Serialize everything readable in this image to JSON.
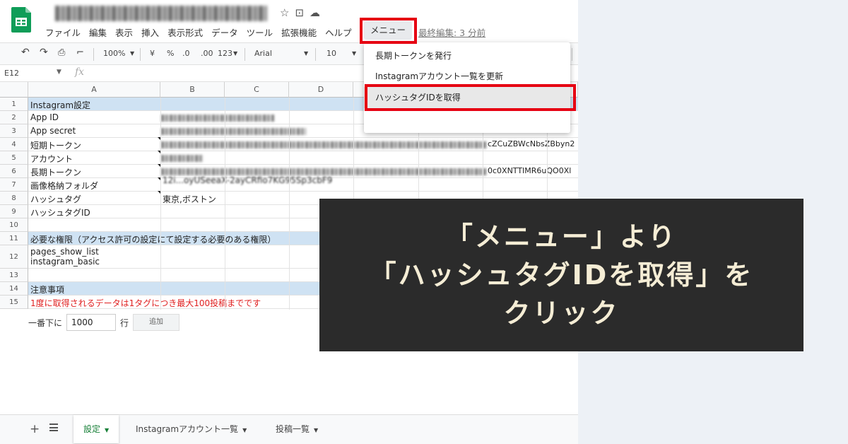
{
  "app": {
    "doc_title": "",
    "menus": [
      "ファイル",
      "編集",
      "表示",
      "挿入",
      "表示形式",
      "データ",
      "ツール",
      "拡張機能",
      "ヘルプ"
    ],
    "active_menu": "メニュー",
    "last_edit": "最終編集: 3 分前"
  },
  "toolbar": {
    "zoom": "100%",
    "currency": "¥",
    "percent": "%",
    "decimal_less": ".0",
    "decimal_more": ".00",
    "number_format": "123",
    "font": "Arial",
    "font_size": "10"
  },
  "formula_bar": {
    "name_box": "E12",
    "fx": "fx"
  },
  "columns": [
    "A",
    "B",
    "C",
    "D"
  ],
  "rows": [
    {
      "num": "1",
      "a": "Instagram設定",
      "b": ""
    },
    {
      "num": "2",
      "a": "App ID",
      "b": ""
    },
    {
      "num": "3",
      "a": "App secret",
      "b": ""
    },
    {
      "num": "4",
      "a": "短期トークン",
      "b": ""
    },
    {
      "num": "5",
      "a": "アカウント",
      "b": ""
    },
    {
      "num": "6",
      "a": "長期トークン",
      "b": ""
    },
    {
      "num": "7",
      "a": "画像格納フォルダ",
      "b": "12i...oyUSeeaX-2ayCRfio7KG95Sp3cbF9"
    },
    {
      "num": "8",
      "a": "ハッシュタグ",
      "b": "東京,ボストン"
    },
    {
      "num": "9",
      "a": "ハッシュタグID",
      "b": ""
    },
    {
      "num": "10",
      "a": "",
      "b": ""
    },
    {
      "num": "11",
      "a": "必要な権限（アクセス許可の設定にて設定する必要のある権限）",
      "b": ""
    },
    {
      "num": "12",
      "a": "pages_show_list",
      "a2": "instagram_basic",
      "b": ""
    },
    {
      "num": "13",
      "a": "",
      "b": ""
    },
    {
      "num": "14",
      "a": "注意事項",
      "b": ""
    },
    {
      "num": "15",
      "a": "1度に取得されるデータは1タグにつき最大100投稿までです",
      "b": ""
    }
  ],
  "visible_tokens": {
    "row4_tail": "cZCuZBWcNbsZBbyn2",
    "row6_tail": "0c0XNTTIMR6uQO0Xl"
  },
  "add_rows": {
    "label_before": "一番下に",
    "value": "1000",
    "label_after": "行",
    "button": "追加"
  },
  "dropdown": {
    "items": [
      "長期トークンを発行",
      "Instagramアカウント一覧を更新",
      "ハッシュタグIDを取得"
    ]
  },
  "sheet_tabs": [
    "設定",
    "Instagramアカウント一覧",
    "投稿一覧"
  ],
  "overlay": {
    "line1": "「メニュー」より",
    "line2": "「ハッシュタグIDを取得」を",
    "line3": "クリック"
  },
  "colors": {
    "highlight_red": "#e60012",
    "header_blue": "#cfe2f3",
    "overlay_bg": "#2b2b2b",
    "overlay_text": "#f5edd5",
    "active_tab_green": "#188038"
  }
}
